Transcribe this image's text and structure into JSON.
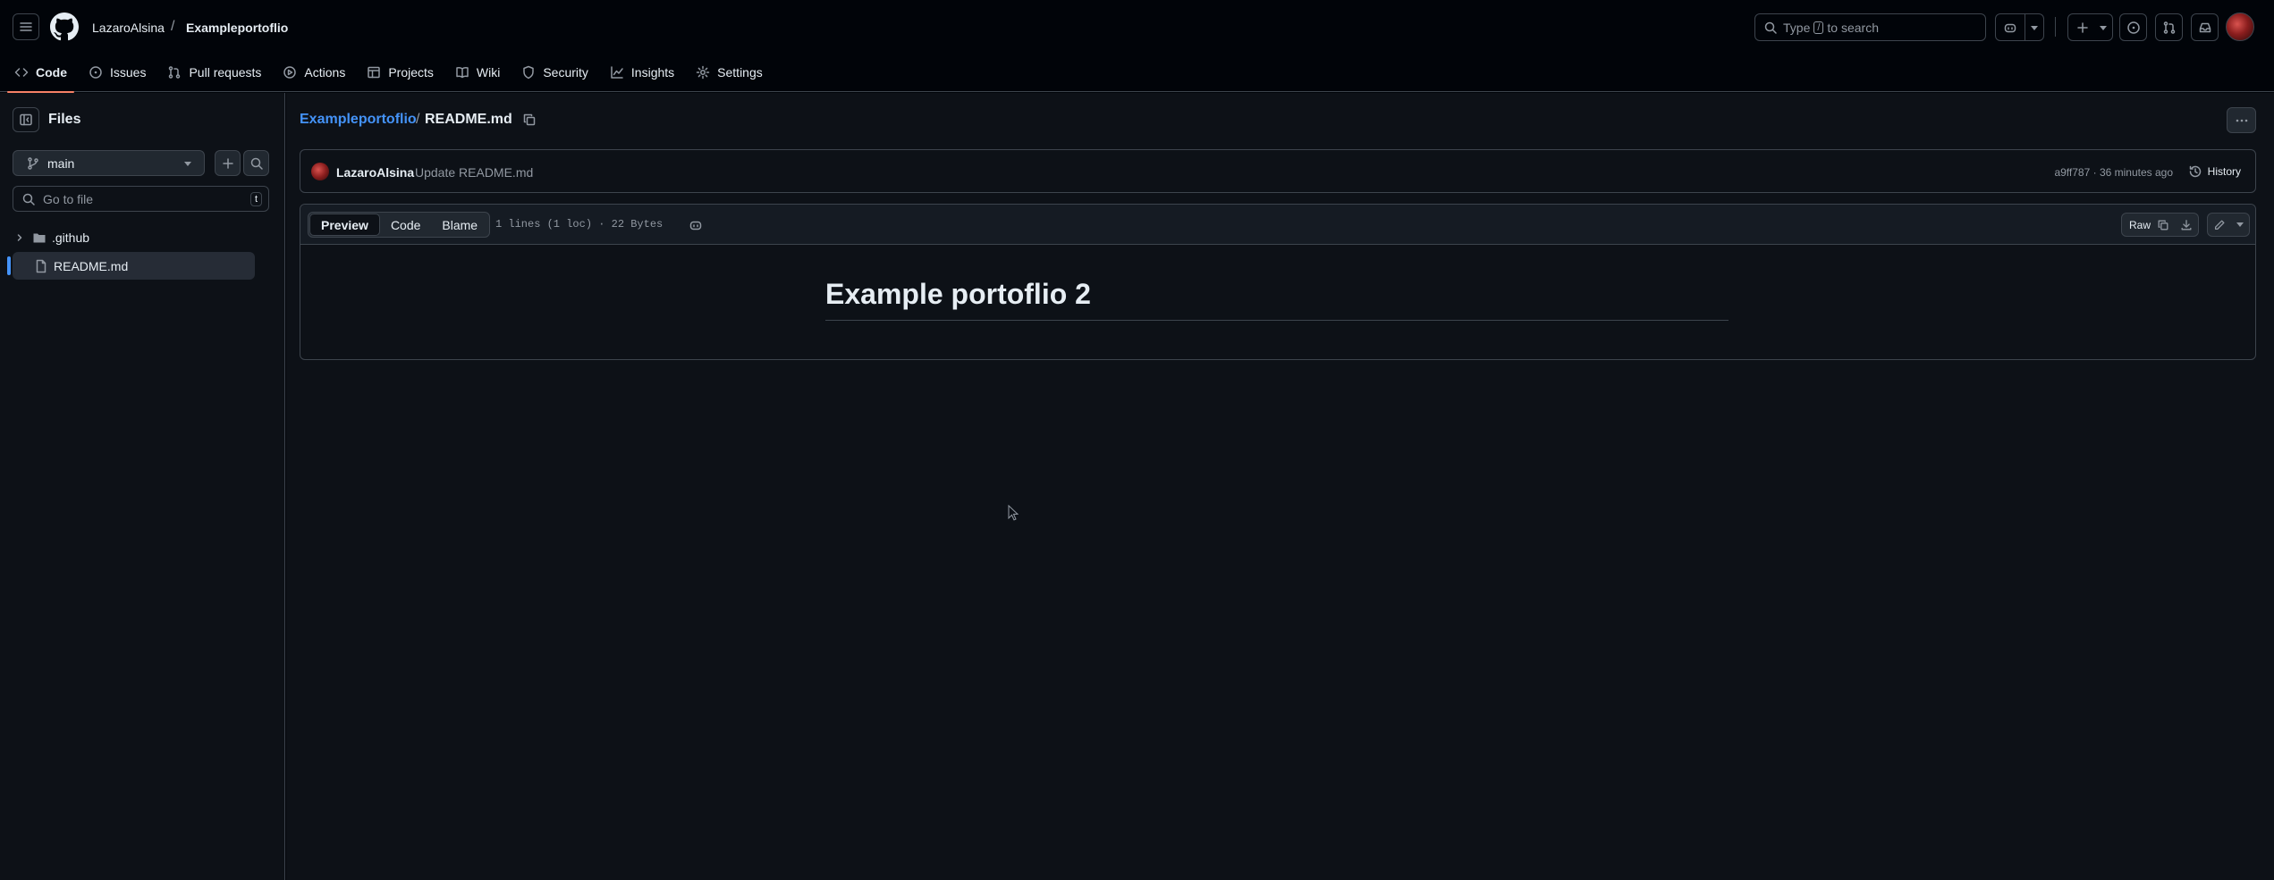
{
  "header": {
    "owner": "LazaroAlsina",
    "separator": "/",
    "repo": "Exampleportoflio",
    "search_prefix": "Type",
    "search_key": "/",
    "search_suffix": "to search"
  },
  "nav": {
    "tabs": [
      {
        "label": "Code",
        "icon": "code-icon",
        "selected": true
      },
      {
        "label": "Issues",
        "icon": "issue-icon"
      },
      {
        "label": "Pull requests",
        "icon": "pull-request-icon"
      },
      {
        "label": "Actions",
        "icon": "play-icon"
      },
      {
        "label": "Projects",
        "icon": "table-icon"
      },
      {
        "label": "Wiki",
        "icon": "book-icon"
      },
      {
        "label": "Security",
        "icon": "shield-icon"
      },
      {
        "label": "Insights",
        "icon": "graph-icon"
      },
      {
        "label": "Settings",
        "icon": "gear-icon"
      }
    ]
  },
  "sidebar": {
    "title": "Files",
    "branch": "main",
    "goto_placeholder": "Go to file",
    "goto_key": "t",
    "tree": [
      {
        "name": ".github",
        "type": "folder"
      },
      {
        "name": "README.md",
        "type": "file",
        "selected": true
      }
    ]
  },
  "main": {
    "path_repo": "Exampleportoflio",
    "path_sep": "/",
    "path_file": "README.md",
    "commit": {
      "author": "LazaroAlsina",
      "message": "Update README.md",
      "meta": "a9ff787 · 36 minutes ago",
      "history_label": "History"
    },
    "file": {
      "views": [
        "Preview",
        "Code",
        "Blame"
      ],
      "selected_view": "Preview",
      "stats": "1 lines (1 loc) · 22 Bytes",
      "raw_label": "Raw",
      "heading": "Example portoflio 2"
    }
  },
  "colors": {
    "accent_link": "#4493f8",
    "tab_underline": "#f78166",
    "background": "#0d1117",
    "border": "#3d444d"
  }
}
